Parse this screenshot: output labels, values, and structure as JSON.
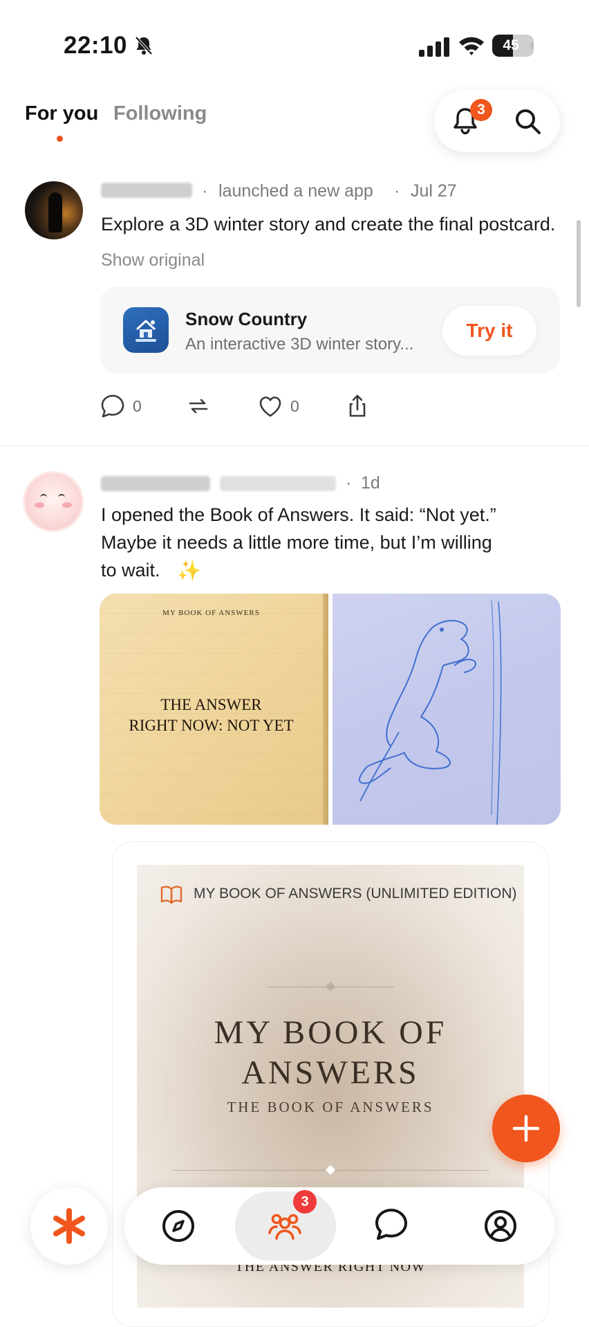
{
  "status_bar": {
    "time": "22:10",
    "battery": "45",
    "battery_level": 0.45
  },
  "feed_tabs": [
    {
      "label": "For you",
      "active": true
    },
    {
      "label": "Following",
      "active": false
    }
  ],
  "notifications": {
    "badge_count": "3"
  },
  "icons": {
    "bell_off": "bell-off-icon",
    "signal": "signal-icon",
    "wifi": "wifi-icon",
    "battery": "battery-icon",
    "notifications": "bell-icon",
    "search": "search-icon",
    "comment": "comment-icon",
    "repost": "repost-icon",
    "like": "heart-icon",
    "share": "share-icon",
    "book": "book-icon",
    "add": "plus-icon",
    "home": "asterisk-icon",
    "explore": "compass-icon",
    "community": "people-icon",
    "messages": "chat-bubble-icon",
    "profile": "profile-icon"
  },
  "colors": {
    "accent": "#f0561d",
    "badge_red": "#ef3b3b",
    "muted_text": "#8a8a8a"
  },
  "posts": [
    {
      "action": "launched a new app",
      "separator": "·",
      "date": "Jul 27",
      "text": "Explore a 3D winter story and create the final postcard.",
      "show_original": "Show original",
      "app": {
        "title": "Snow Country",
        "subtitle": "An interactive 3D winter story...",
        "cta": "Try it"
      },
      "comments": "0",
      "likes": "0"
    },
    {
      "separator": "·",
      "date": "1d",
      "text_lines": [
        "I opened the Book of Answers. It said: “Not yet.”",
        "Maybe it needs a little more time, but I’m willing",
        "to wait."
      ],
      "sparkle": "✨",
      "image_left": {
        "header": "MY BOOK OF ANSWERS",
        "line1": "THE ANSWER",
        "line2": "RIGHT NOW: NOT YET"
      },
      "embed": {
        "header": "MY BOOK OF ANSWERS (UNLIMITED EDITION)",
        "title_line1": "MY BOOK OF",
        "title_line2": "ANSWERS",
        "subtitle": "THE BOOK OF ANSWERS",
        "footer": "THE ANSWER RIGHT NOW"
      }
    }
  ],
  "bottom_nav": {
    "community_badge": "3",
    "active": "community"
  }
}
